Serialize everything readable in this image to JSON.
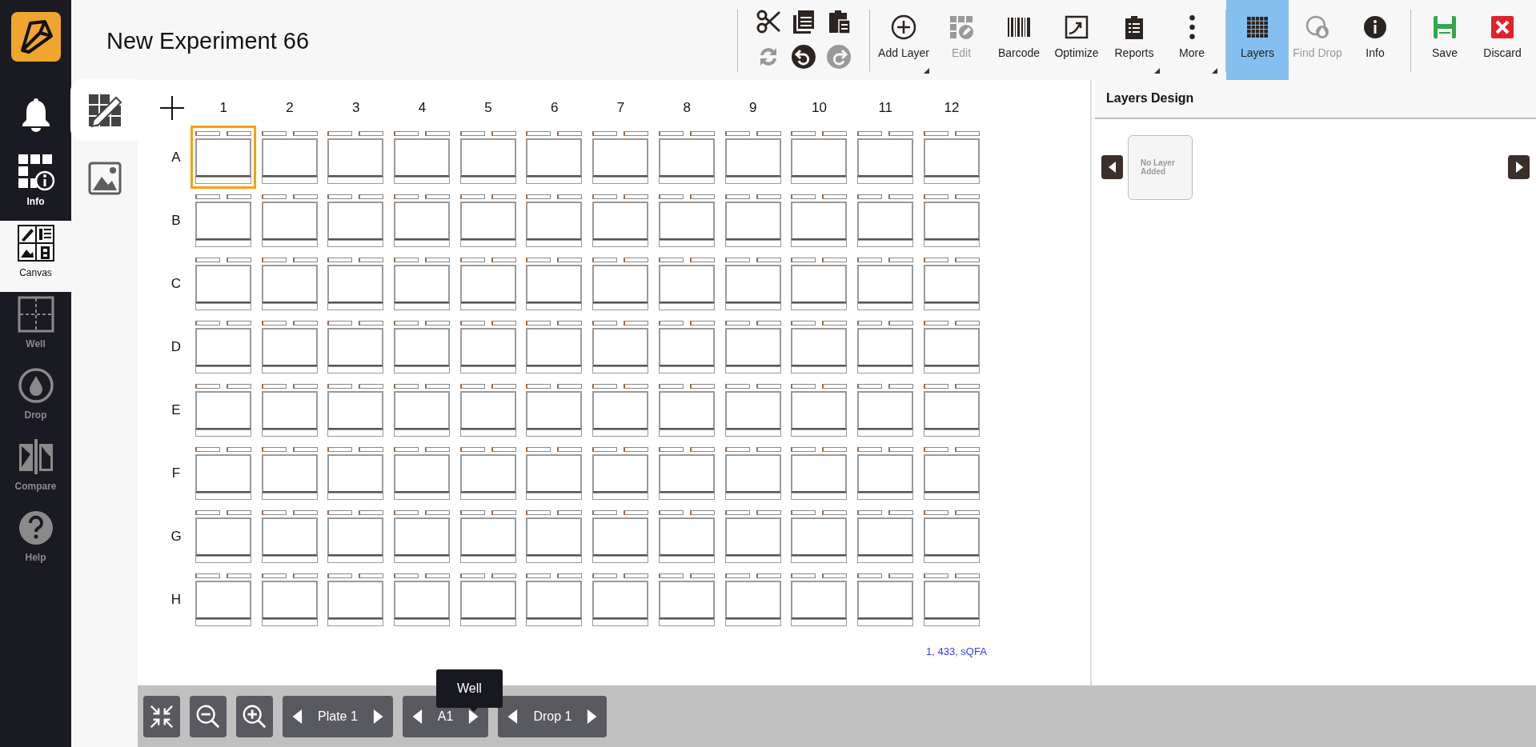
{
  "sidebar": {
    "items": [
      {
        "label": "Info",
        "selected": false,
        "disabled": false
      },
      {
        "label": "Canvas",
        "selected": true,
        "disabled": false
      },
      {
        "label": "Well",
        "selected": false,
        "disabled": true
      },
      {
        "label": "Drop",
        "selected": false,
        "disabled": true
      },
      {
        "label": "Compare",
        "selected": false,
        "disabled": true
      },
      {
        "label": "Help",
        "selected": false,
        "disabled": true
      }
    ]
  },
  "header": {
    "title": "New Experiment 66"
  },
  "toolbar": {
    "clipboard": [
      {
        "disabled": false
      },
      {
        "disabled": false
      },
      {
        "disabled": false
      },
      {
        "disabled": true
      },
      {
        "disabled": false
      },
      {
        "disabled": true
      }
    ],
    "groups": [
      [
        {
          "label": "Add Layer",
          "disabled": false,
          "selected": false,
          "dropdown": true
        },
        {
          "label": "Edit",
          "disabled": true,
          "selected": false,
          "dropdown": false
        },
        {
          "label": "Barcode",
          "disabled": false,
          "selected": false,
          "dropdown": false
        },
        {
          "label": "Optimize",
          "disabled": false,
          "selected": false,
          "dropdown": false
        },
        {
          "label": "Reports",
          "disabled": false,
          "selected": false,
          "dropdown": true
        },
        {
          "label": "More",
          "disabled": false,
          "selected": false,
          "dropdown": true
        }
      ],
      [
        {
          "label": "Layers",
          "disabled": false,
          "selected": true,
          "dropdown": false
        },
        {
          "label": "Find Drop",
          "disabled": true,
          "selected": false,
          "dropdown": false
        },
        {
          "label": "Info",
          "disabled": false,
          "selected": false,
          "dropdown": false
        }
      ],
      [
        {
          "label": "Save",
          "disabled": false,
          "selected": false,
          "dropdown": false
        },
        {
          "label": "Discard",
          "disabled": false,
          "selected": false,
          "dropdown": false
        }
      ]
    ]
  },
  "canvas_tabs": [
    {
      "selected": true
    },
    {
      "selected": false
    }
  ],
  "plate": {
    "columns": [
      "1",
      "2",
      "3",
      "4",
      "5",
      "6",
      "7",
      "8",
      "9",
      "10",
      "11",
      "12"
    ],
    "rows": [
      {
        "label": "A",
        "wells": [
          {
            "selected": true
          },
          {
            "selected": false
          },
          {
            "selected": false
          },
          {
            "selected": false
          },
          {
            "selected": false
          },
          {
            "selected": false
          },
          {
            "selected": false
          },
          {
            "selected": false
          },
          {
            "selected": false
          },
          {
            "selected": false
          },
          {
            "selected": false
          },
          {
            "selected": false
          }
        ]
      },
      {
        "label": "B",
        "wells": [
          {
            "selected": false
          },
          {
            "selected": false
          },
          {
            "selected": false
          },
          {
            "selected": false
          },
          {
            "selected": false
          },
          {
            "selected": false
          },
          {
            "selected": false
          },
          {
            "selected": false
          },
          {
            "selected": false
          },
          {
            "selected": false
          },
          {
            "selected": false
          },
          {
            "selected": false
          }
        ]
      },
      {
        "label": "C",
        "wells": [
          {
            "selected": false
          },
          {
            "selected": false
          },
          {
            "selected": false
          },
          {
            "selected": false
          },
          {
            "selected": false
          },
          {
            "selected": false
          },
          {
            "selected": false
          },
          {
            "selected": false
          },
          {
            "selected": false
          },
          {
            "selected": false
          },
          {
            "selected": false
          },
          {
            "selected": false
          }
        ]
      },
      {
        "label": "D",
        "wells": [
          {
            "selected": false
          },
          {
            "selected": false
          },
          {
            "selected": false
          },
          {
            "selected": false
          },
          {
            "selected": false
          },
          {
            "selected": false
          },
          {
            "selected": false
          },
          {
            "selected": false
          },
          {
            "selected": false
          },
          {
            "selected": false
          },
          {
            "selected": false
          },
          {
            "selected": false
          }
        ]
      },
      {
        "label": "E",
        "wells": [
          {
            "selected": false
          },
          {
            "selected": false
          },
          {
            "selected": false
          },
          {
            "selected": false
          },
          {
            "selected": false
          },
          {
            "selected": false
          },
          {
            "selected": false
          },
          {
            "selected": false
          },
          {
            "selected": false
          },
          {
            "selected": false
          },
          {
            "selected": false
          },
          {
            "selected": false
          }
        ]
      },
      {
        "label": "F",
        "wells": [
          {
            "selected": false
          },
          {
            "selected": false
          },
          {
            "selected": false
          },
          {
            "selected": false
          },
          {
            "selected": false
          },
          {
            "selected": false
          },
          {
            "selected": false
          },
          {
            "selected": false
          },
          {
            "selected": false
          },
          {
            "selected": false
          },
          {
            "selected": false
          },
          {
            "selected": false
          }
        ]
      },
      {
        "label": "G",
        "wells": [
          {
            "selected": false
          },
          {
            "selected": false
          },
          {
            "selected": false
          },
          {
            "selected": false
          },
          {
            "selected": false
          },
          {
            "selected": false
          },
          {
            "selected": false
          },
          {
            "selected": false
          },
          {
            "selected": false
          },
          {
            "selected": false
          },
          {
            "selected": false
          },
          {
            "selected": false
          }
        ]
      },
      {
        "label": "H",
        "wells": [
          {
            "selected": false
          },
          {
            "selected": false
          },
          {
            "selected": false
          },
          {
            "selected": false
          },
          {
            "selected": false
          },
          {
            "selected": false
          },
          {
            "selected": false
          },
          {
            "selected": false
          },
          {
            "selected": false
          },
          {
            "selected": false
          },
          {
            "selected": false
          },
          {
            "selected": false
          }
        ]
      }
    ],
    "footnote": "1, 433, sQFA"
  },
  "bottom_bar": {
    "navigators": [
      {
        "label": "Plate 1"
      },
      {
        "label": "A1"
      },
      {
        "label": "Drop 1"
      }
    ],
    "tooltip": "Well"
  },
  "layers_panel": {
    "title": "Layers Design",
    "placeholder_card": "No Layer\nAdded"
  }
}
